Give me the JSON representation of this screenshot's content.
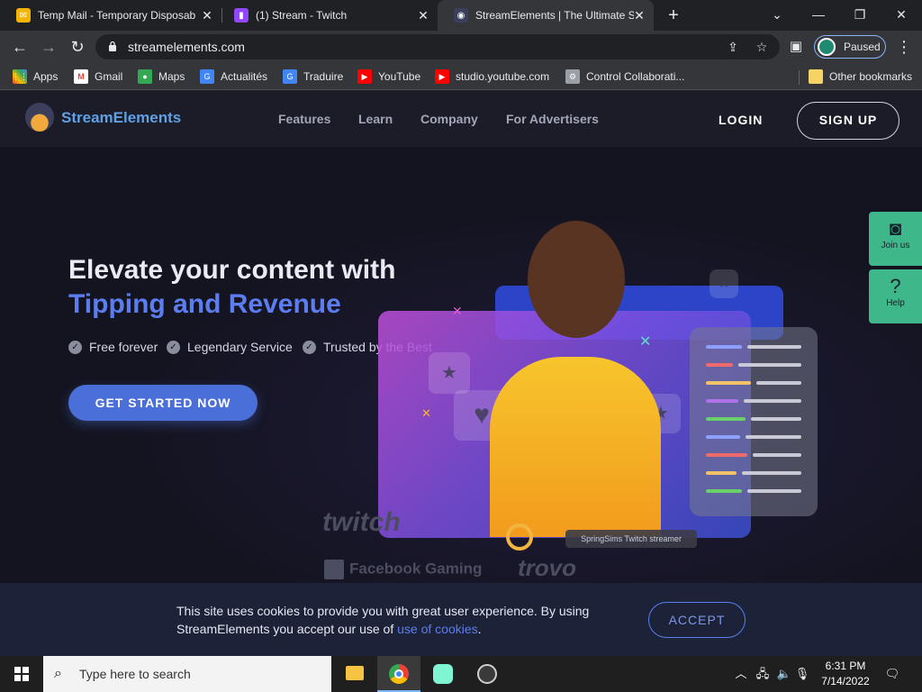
{
  "browser": {
    "tabs": [
      {
        "title": "Temp Mail - Temporary Disposab",
        "icon": "envelope-icon"
      },
      {
        "title": "(1) Stream - Twitch",
        "icon": "twitch-icon"
      },
      {
        "title": "StreamElements | The Ultimate St",
        "icon": "streamelements-icon",
        "active": true
      }
    ],
    "url": "streamelements.com",
    "profile_status": "Paused",
    "bookmarks": [
      {
        "label": "Apps",
        "icon": "apps-grid-icon"
      },
      {
        "label": "Gmail",
        "icon": "gmail-icon"
      },
      {
        "label": "Maps",
        "icon": "maps-icon"
      },
      {
        "label": "Actualités",
        "icon": "google-news-icon"
      },
      {
        "label": "Traduire",
        "icon": "translate-icon"
      },
      {
        "label": "YouTube",
        "icon": "youtube-icon"
      },
      {
        "label": "studio.youtube.com",
        "icon": "youtube-icon"
      },
      {
        "label": "Control Collaborati...",
        "icon": "control-icon"
      }
    ],
    "other_bookmarks": "Other bookmarks"
  },
  "site": {
    "brand": "StreamElements",
    "nav": [
      "Features",
      "Learn",
      "Company",
      "For Advertisers"
    ],
    "login": "LOGIN",
    "signup": "SIGN UP",
    "hero": {
      "title_line1": "Elevate your content with",
      "title_line2": "Tipping and Revenue",
      "features": [
        "Free forever",
        "Legendary Service",
        "Trusted by the Best"
      ],
      "cta": "GET STARTED NOW",
      "streamer_name": "SpringSims",
      "streamer_role": "Twitch streamer",
      "platforms": [
        "twitch",
        "Facebook Gaming",
        "trovo"
      ]
    },
    "side_widgets": [
      {
        "label": "Join us",
        "icon": "discord-icon"
      },
      {
        "label": "Help",
        "icon": "help-circle-icon"
      }
    ],
    "cookie": {
      "text": "This site uses cookies to provide you with great user experience. By using StreamElements you accept our use of",
      "link": "use of cookies",
      "accept": "ACCEPT"
    }
  },
  "taskbar": {
    "search_placeholder": "Type here to search",
    "apps": [
      "file-explorer-icon",
      "chrome-icon",
      "streamlabs-icon",
      "obs-icon"
    ],
    "time": "6:31 PM",
    "date": "7/14/2022"
  },
  "colors": {
    "accent": "#5b7df0",
    "cta": "#4a6fd8",
    "side_widget": "#3eb88a"
  }
}
